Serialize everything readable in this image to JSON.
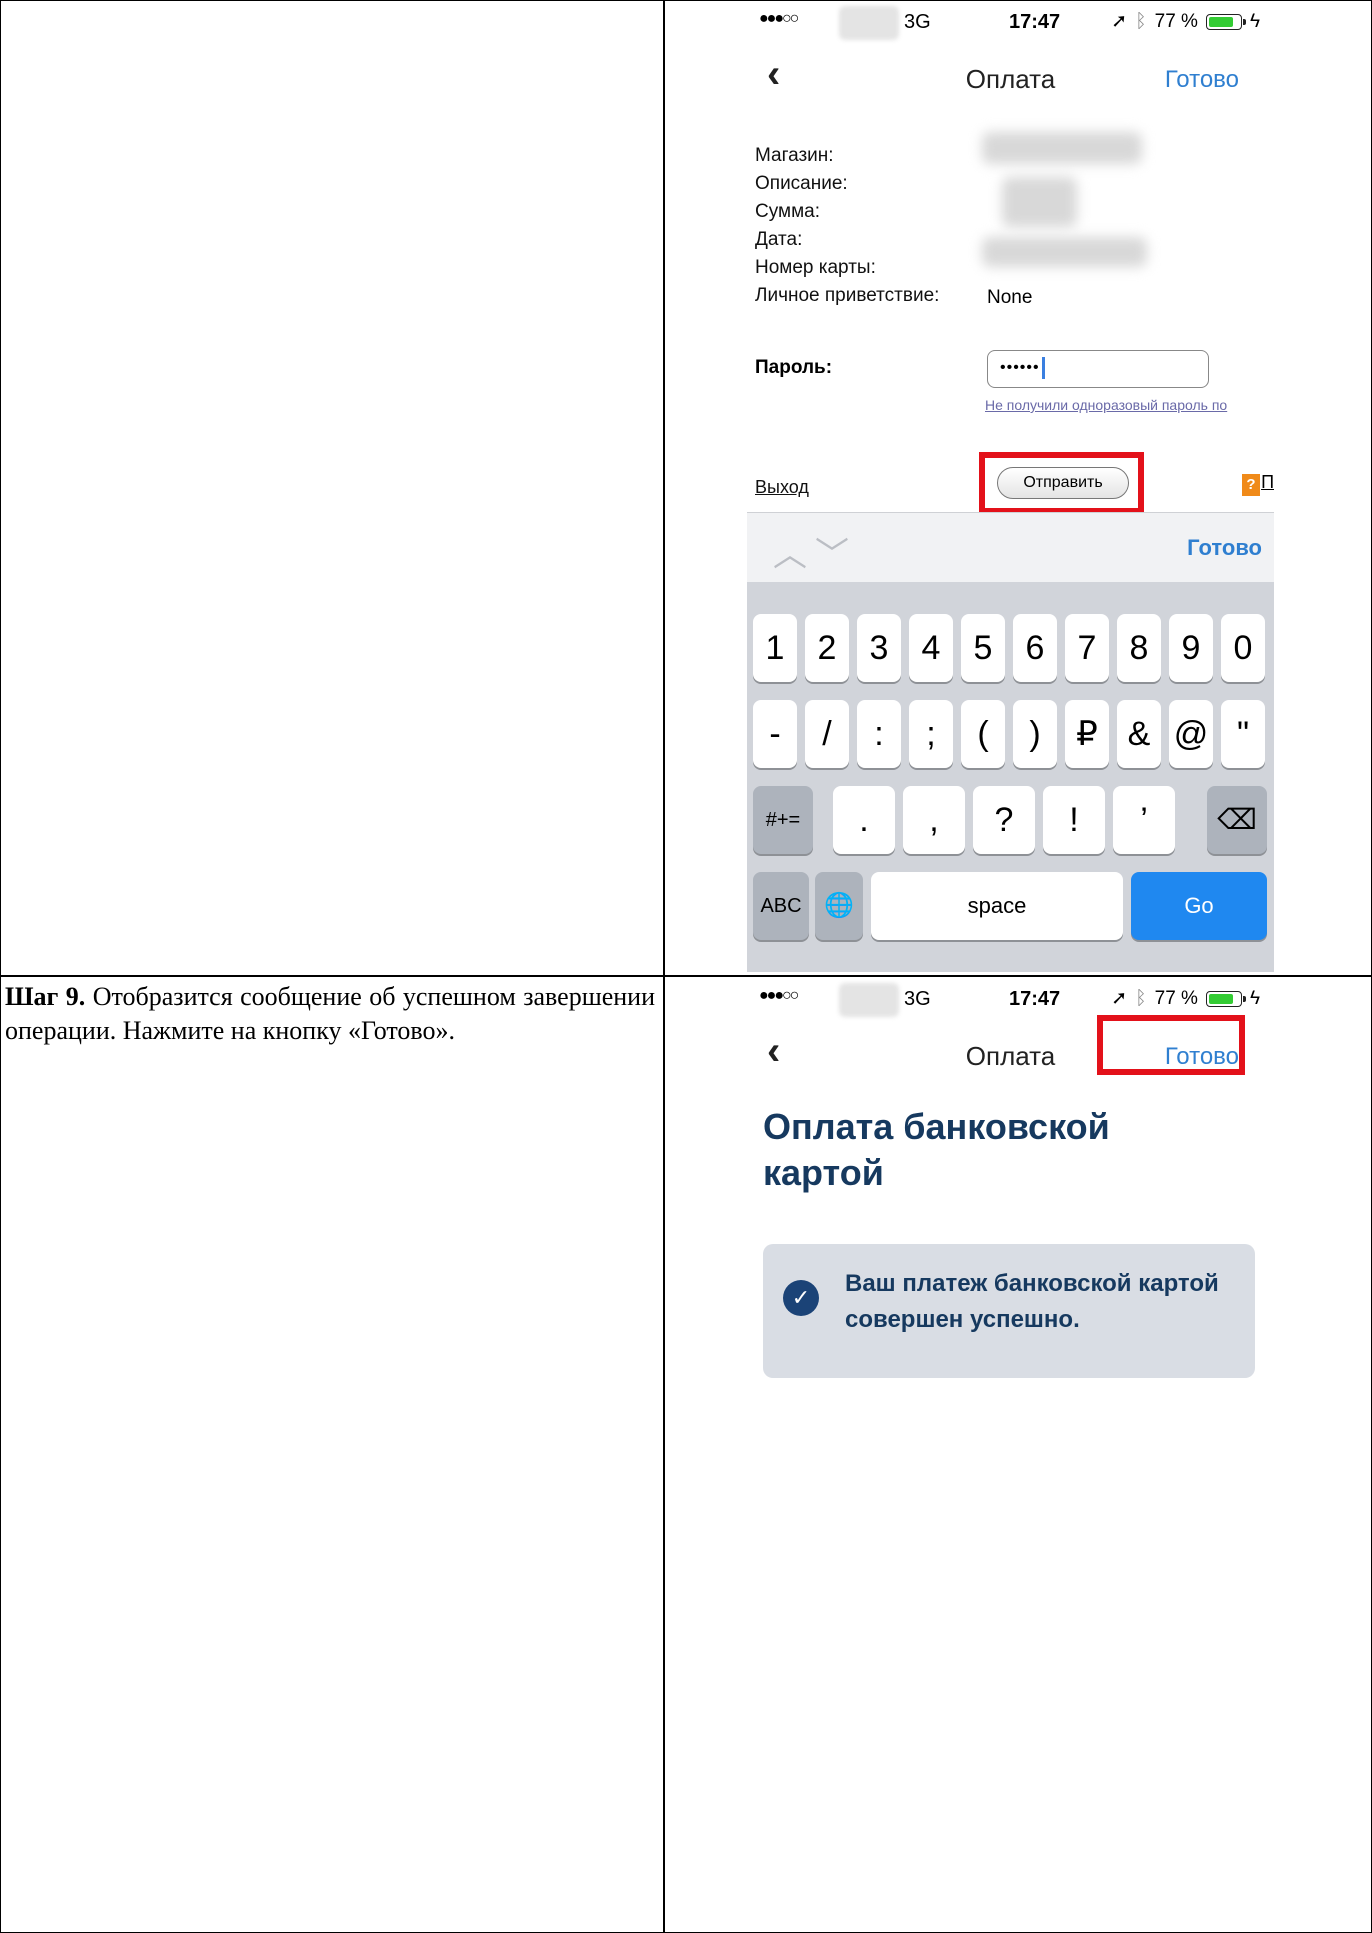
{
  "step_text": {
    "step_label": "Шаг 9.",
    "body": "Отобразится сообщение об успешном завершении операции. Нажмите на кнопку «Готово»."
  },
  "status_bar": {
    "signal": "●●●○○",
    "network": "3G",
    "time": "17:47",
    "battery": "77 %",
    "location_icon": "location-arrow-icon",
    "bluetooth_icon": "bluetooth-icon"
  },
  "phone1": {
    "nav": {
      "back": "‹",
      "title": "Оплата",
      "done": "Готово"
    },
    "form": {
      "labels": [
        "Магазин:",
        "Описание:",
        "Сумма:",
        "Дата:",
        "Номер карты:",
        "Личное приветствие:"
      ],
      "greeting_value": "None",
      "password_label": "Пароль:",
      "password_value": "••••••",
      "otp_link": "Не получили одноразовый пароль по",
      "exit_link": "Выход",
      "send_button": "Отправить",
      "help_icon": "?",
      "help_cut": "П"
    },
    "accessory": {
      "done": "Готово"
    },
    "keyboard": {
      "row1": [
        "1",
        "2",
        "3",
        "4",
        "5",
        "6",
        "7",
        "8",
        "9",
        "0"
      ],
      "row2": [
        "-",
        "/",
        ":",
        ";",
        "(",
        ")",
        "₽",
        "&",
        "@",
        "\""
      ],
      "row3": [
        "#+=",
        ".",
        ",",
        "?",
        "!",
        "’",
        "⌫"
      ],
      "row4": [
        "ABC",
        "🌐",
        "space",
        "Go"
      ]
    }
  },
  "phone2": {
    "nav": {
      "back": "‹",
      "title": "Оплата",
      "done": "Готово"
    },
    "heading": "Оплата банковской картой",
    "success_message": "Ваш платеж банковской картой совершен успешно."
  },
  "colors": {
    "link_blue": "#2f7fd0",
    "highlight_red": "#e3111a",
    "heading_navy": "#16395f",
    "keyboard_bg": "#d1d4da",
    "go_key": "#1f88f0"
  }
}
